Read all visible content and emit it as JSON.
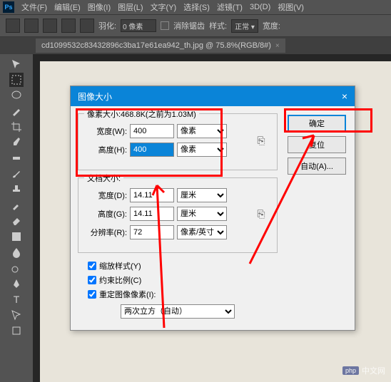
{
  "menubar": {
    "items": [
      "文件(F)",
      "编辑(E)",
      "图像(I)",
      "图层(L)",
      "文字(Y)",
      "选择(S)",
      "滤镜(T)",
      "3D(D)",
      "视图(V)"
    ]
  },
  "optionsbar": {
    "feather_label": "羽化:",
    "feather_value": "0 像素",
    "antialias": "消除锯齿",
    "style_label": "样式:",
    "style_value": "正常",
    "width_label": "宽度:"
  },
  "tab": {
    "title": "cd1099532c83432896c3ba17e61ea942_th.jpg @ 75.8%(RGB/8#)"
  },
  "dialog": {
    "title": "图像大小",
    "pixel_size_label": "像素大小:468.8K(之前为1.03M)",
    "width_label": "宽度(W):",
    "width_value": "400",
    "height_label": "高度(H):",
    "height_value": "400",
    "unit_px": "像素",
    "doc_size_label": "文档大小:",
    "doc_width_label": "宽度(D):",
    "doc_width_value": "14.11",
    "doc_height_label": "高度(G):",
    "doc_height_value": "14.11",
    "unit_cm": "厘米",
    "resolution_label": "分辨率(R):",
    "resolution_value": "72",
    "unit_ppi": "像素/英寸",
    "scale_styles": "缩放样式(Y)",
    "constrain": "约束比例(C)",
    "resample": "重定图像像素(I):",
    "resample_method": "两次立方（自动）",
    "ok": "确定",
    "reset": "复位",
    "auto": "自动(A)..."
  },
  "watermark": {
    "badge": "php",
    "text": "中文网"
  }
}
